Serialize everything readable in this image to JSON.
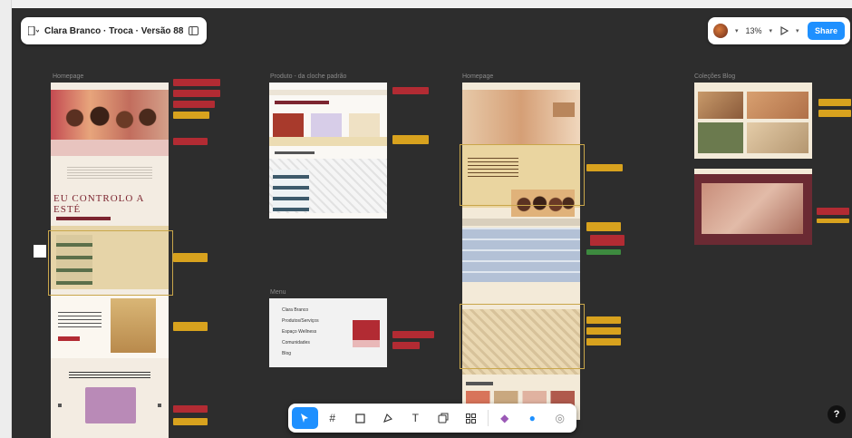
{
  "file": {
    "title": "Clara Branco · Troca · Versão 88"
  },
  "top_right": {
    "zoom": "13%"
  },
  "buttons": {
    "share": "Share"
  },
  "help": {
    "label": "?"
  },
  "frames": {
    "homepage": {
      "label": "Homepage"
    },
    "produto": {
      "label": "Produto - da cloche padrão"
    },
    "homepage2": {
      "label": "Homepage"
    },
    "menu": {
      "label": "Menu"
    },
    "coleções": {
      "label": "Coleções Blog"
    }
  },
  "homepage_headline": "EU CONTROLO A ESTÉ",
  "menu_items": [
    "Clara Branco",
    "Produtos/Serviços",
    "Espaço Wellness",
    "Comunidades",
    "Blog"
  ],
  "toolbar": {
    "items": [
      "move",
      "frame",
      "shape",
      "pen",
      "text",
      "resources",
      "layout",
      "dev-mode",
      "comment",
      "share-canvas"
    ]
  },
  "colors": {
    "canvas": "#2d2d2d",
    "sticky_red": "#b22b33",
    "sticky_yellow": "#d8a21e",
    "sticky_green": "#3d8a3f",
    "accent": "#1e90ff"
  }
}
